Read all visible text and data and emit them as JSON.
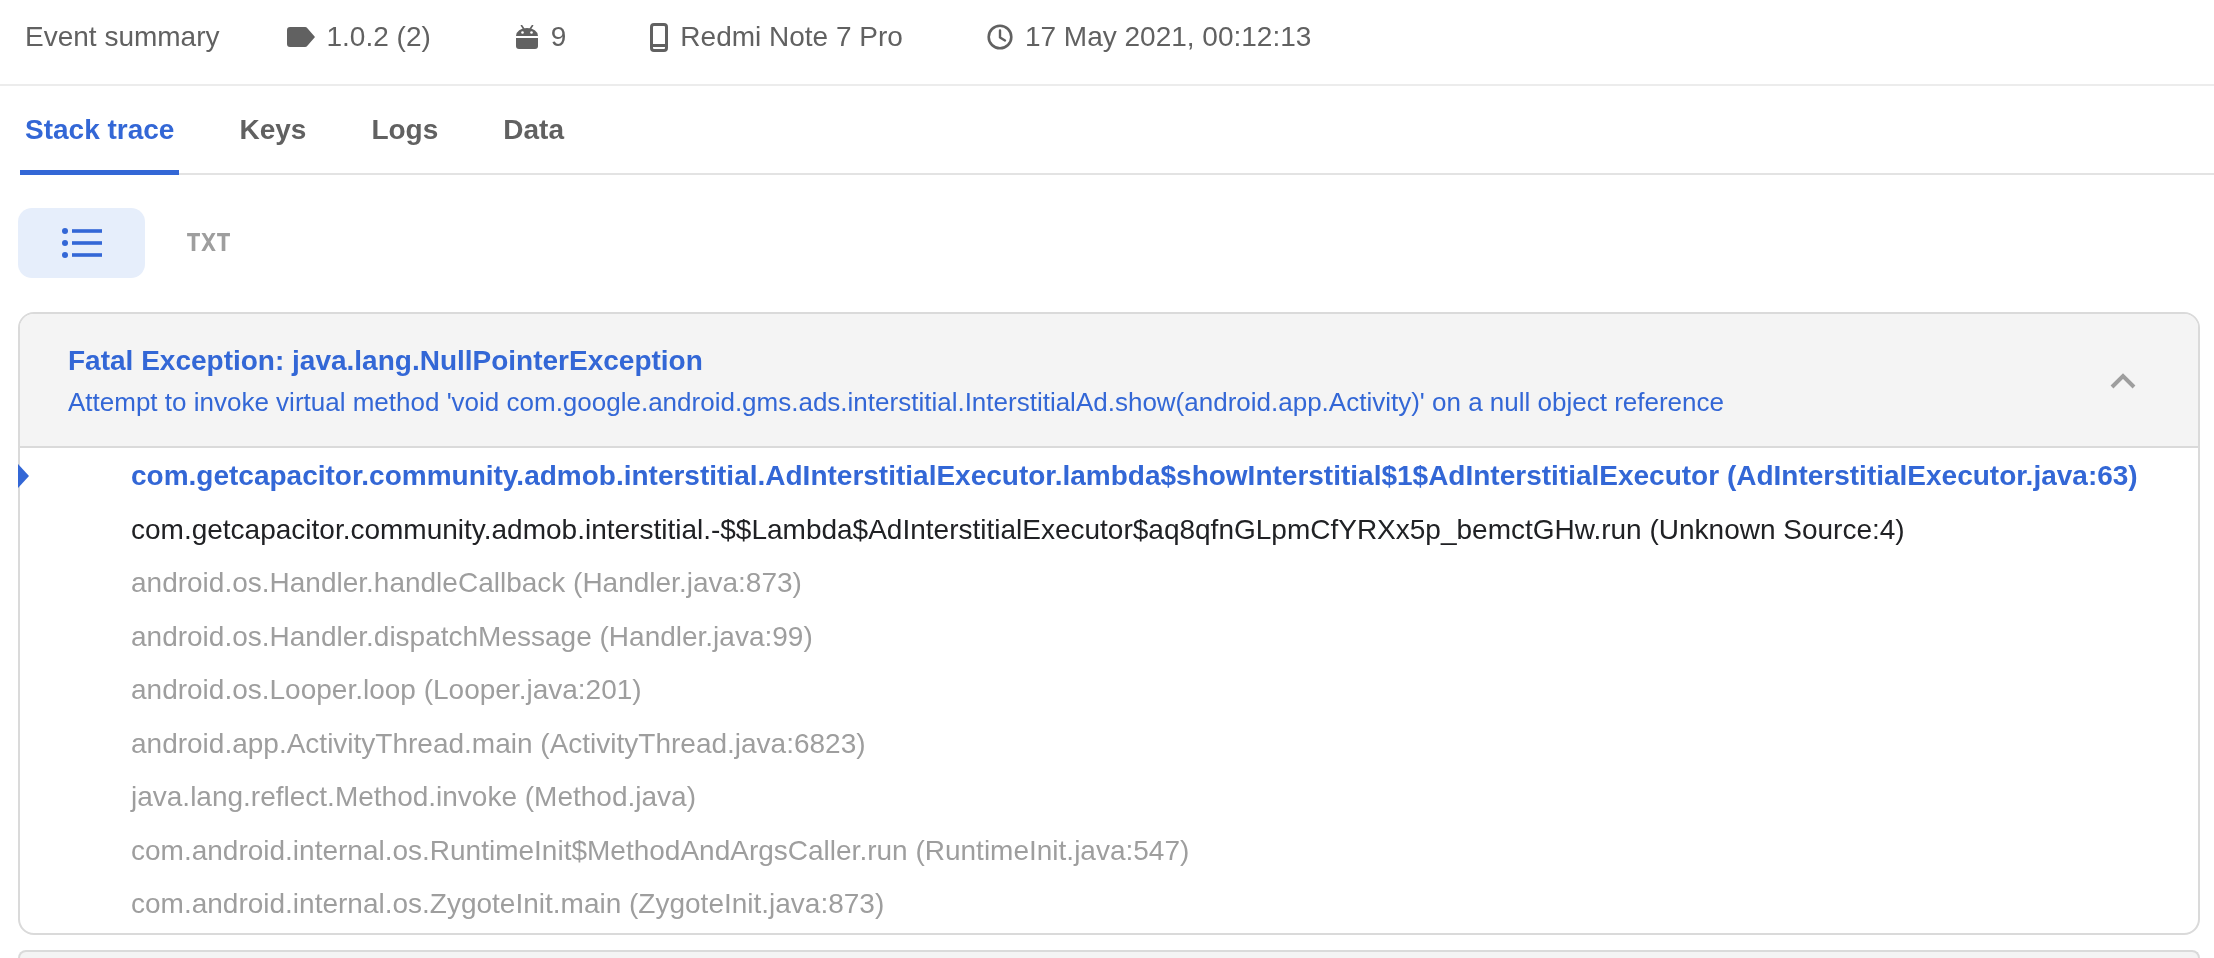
{
  "summary": {
    "title": "Event summary",
    "items": [
      {
        "kind": "version",
        "text": "1.0.2 (2)"
      },
      {
        "kind": "os",
        "text": "9"
      },
      {
        "kind": "device",
        "text": "Redmi Note 7 Pro"
      },
      {
        "kind": "time",
        "text": "17 May 2021, 00:12:13"
      }
    ]
  },
  "tabs": [
    {
      "label": "Stack trace",
      "selected": true
    },
    {
      "label": "Keys",
      "selected": false
    },
    {
      "label": "Logs",
      "selected": false
    },
    {
      "label": "Data",
      "selected": false
    }
  ],
  "view_toggle": [
    {
      "kind": "list",
      "selected": true
    },
    {
      "kind": "text",
      "label": "TXT",
      "selected": false
    }
  ],
  "exception": {
    "title": "Fatal Exception: java.lang.NullPointerException",
    "message": "Attempt to invoke virtual method 'void com.google.android.gms.ads.interstitial.InterstitialAd.show(android.app.Activity)' on a null object reference",
    "expanded": true,
    "frames": [
      {
        "kind": "blamed",
        "text": "com.getcapacitor.community.admob.interstitial.AdInterstitialExecutor.lambda$showInterstitial$1$AdInterstitialExecutor (AdInterstitialExecutor.java:63)"
      },
      {
        "kind": "app",
        "text": "com.getcapacitor.community.admob.interstitial.-$$Lambda$AdInterstitialExecutor$aq8qfnGLpmCfYRXx5p_bemctGHw.run (Unknown Source:4)"
      },
      {
        "kind": "system",
        "text": "android.os.Handler.handleCallback (Handler.java:873)"
      },
      {
        "kind": "system",
        "text": "android.os.Handler.dispatchMessage (Handler.java:99)"
      },
      {
        "kind": "system",
        "text": "android.os.Looper.loop (Looper.java:201)"
      },
      {
        "kind": "system",
        "text": "android.app.ActivityThread.main (ActivityThread.java:6823)"
      },
      {
        "kind": "system",
        "text": "java.lang.reflect.Method.invoke (Method.java)"
      },
      {
        "kind": "system",
        "text": "com.android.internal.os.RuntimeInit$MethodAndArgsCaller.run (RuntimeInit.java:547)"
      },
      {
        "kind": "system",
        "text": "com.android.internal.os.ZygoteInit.main (ZygoteInit.java:873)"
      }
    ]
  }
}
